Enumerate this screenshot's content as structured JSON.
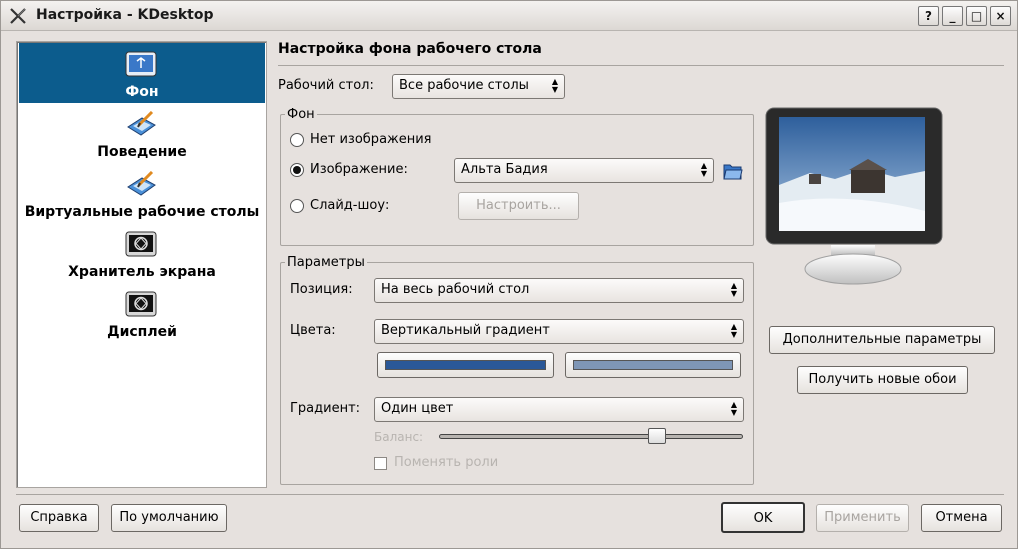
{
  "window": {
    "title": "Настройка - KDesktop",
    "buttons": [
      "?",
      "_",
      "□",
      "×"
    ]
  },
  "sidebar": {
    "items": [
      {
        "label": "Фон",
        "icon": "desktop-background-icon",
        "selected": true
      },
      {
        "label": "Поведение",
        "icon": "desktop-behavior-icon"
      },
      {
        "label": "Виртуальные рабочие столы",
        "icon": "virtual-desktops-icon"
      },
      {
        "label": "Хранитель экрана",
        "icon": "screensaver-icon"
      },
      {
        "label": "Дисплей",
        "icon": "display-icon"
      }
    ]
  },
  "panel": {
    "title": "Настройка фона рабочего стола",
    "desktop_label": "Рабочий стол:",
    "desktop_value": "Все рабочие столы",
    "background_group": "Фон",
    "no_image": "Нет изображения",
    "image": "Изображение:",
    "image_value": "Альта Бадия",
    "slideshow": "Слайд-шоу:",
    "configure_button": "Настроить...",
    "params_group": "Параметры",
    "position_label": "Позиция:",
    "position_value": "На весь рабочий стол",
    "colors_label": "Цвета:",
    "colors_value": "Вертикальный градиент",
    "color1": "#2a5898",
    "color2": "#7e96b6",
    "gradient_label": "Градиент:",
    "gradient_value": "Один цвет",
    "balance_label": "Баланс:",
    "balance_value": 0.73,
    "swap_roles": "Поменять роли",
    "advanced_button": "Дополнительные параметры",
    "get_wallpapers_button": "Получить новые обои"
  },
  "footer": {
    "help": "Справка",
    "defaults": "По умолчанию",
    "ok": "OK",
    "apply": "Применить",
    "cancel": "Отмена"
  }
}
